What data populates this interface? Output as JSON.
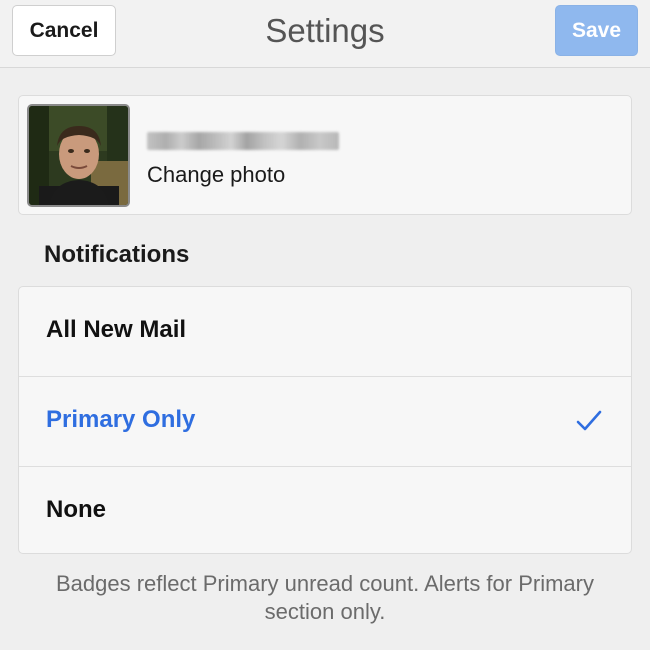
{
  "header": {
    "cancel_label": "Cancel",
    "title": "Settings",
    "save_label": "Save"
  },
  "profile": {
    "avatar_icon": "user-photo",
    "email_redacted": "",
    "change_photo_label": "Change photo"
  },
  "notifications": {
    "heading": "Notifications",
    "options": [
      {
        "label": "All New Mail",
        "selected": false
      },
      {
        "label": "Primary Only",
        "selected": true
      },
      {
        "label": "None",
        "selected": false
      }
    ],
    "selected_icon": "checkmark-icon",
    "footnote": "Badges reflect Primary unread count. Alerts for Primary section only."
  },
  "colors": {
    "accent": "#2f6ee0",
    "save_disabled": "#8fb8ee",
    "background": "#efefef"
  }
}
